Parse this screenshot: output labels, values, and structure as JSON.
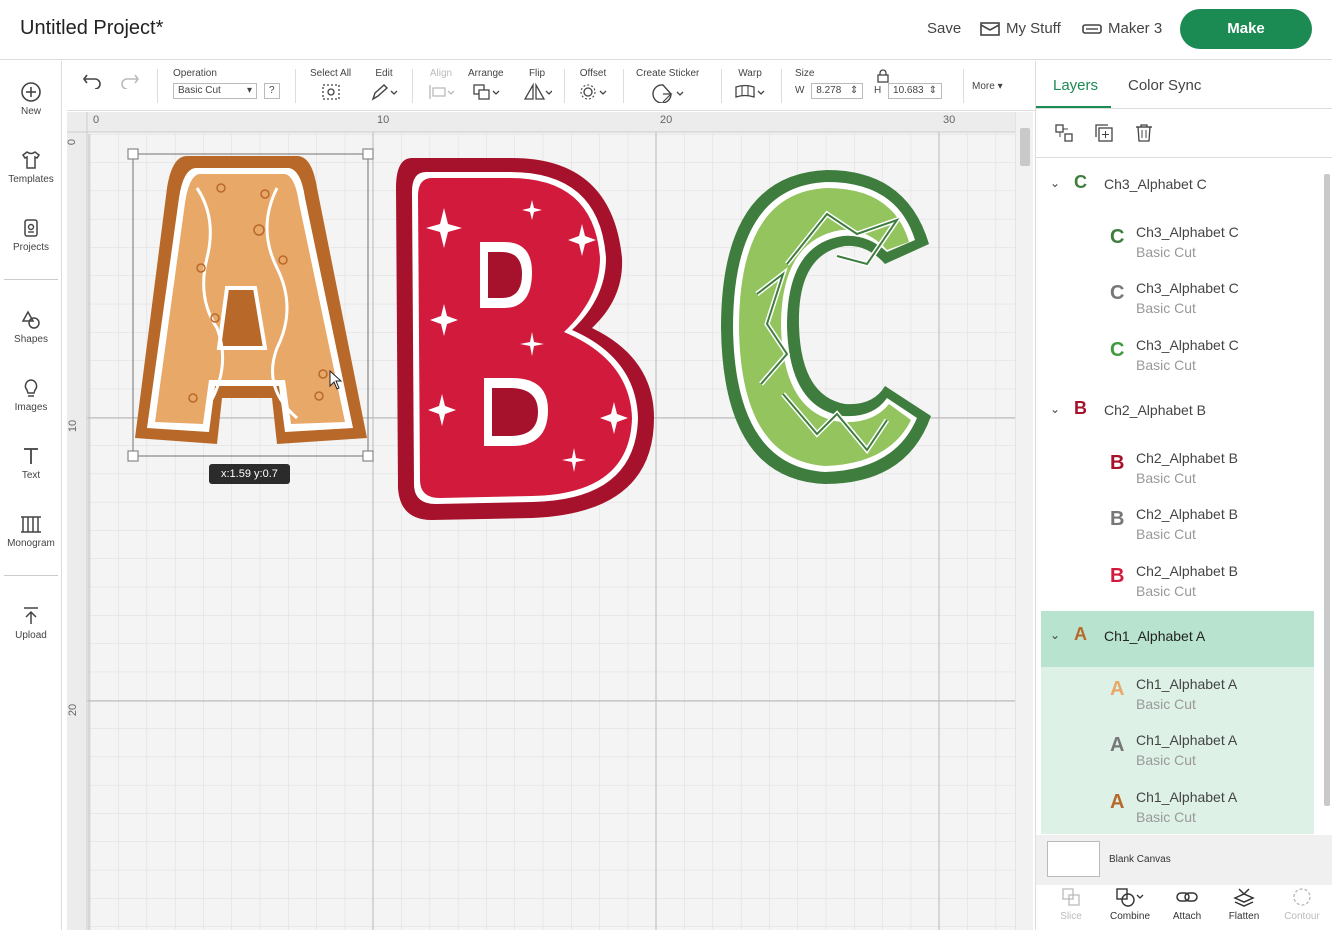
{
  "header": {
    "title": "Untitled Project*",
    "save": "Save",
    "my_stuff": "My Stuff",
    "machine": "Maker 3",
    "make": "Make"
  },
  "leftbar": {
    "items": [
      {
        "label": "New",
        "icon": "plus-circle-icon"
      },
      {
        "label": "Templates",
        "icon": "shirt-icon"
      },
      {
        "label": "Projects",
        "icon": "projects-icon"
      },
      {
        "label": "Shapes",
        "icon": "shapes-icon"
      },
      {
        "label": "Images",
        "icon": "lightbulb-icon"
      },
      {
        "label": "Text",
        "icon": "text-icon"
      },
      {
        "label": "Monogram",
        "icon": "monogram-icon"
      },
      {
        "label": "Upload",
        "icon": "upload-icon"
      }
    ]
  },
  "toolbar": {
    "operation_label": "Operation",
    "operation_value": "Basic Cut",
    "help": "?",
    "select_all": "Select All",
    "edit": "Edit",
    "align": "Align",
    "arrange": "Arrange",
    "flip": "Flip",
    "offset": "Offset",
    "create_sticker": "Create Sticker",
    "warp": "Warp",
    "size": "Size",
    "w_label": "W",
    "w_value": "8.278",
    "h_label": "H",
    "h_value": "10.683",
    "more": "More"
  },
  "ruler": {
    "top": [
      "0",
      "10",
      "20",
      "30"
    ],
    "left": [
      "0",
      "10",
      "20"
    ]
  },
  "canvas": {
    "tooltip": "x:1.59 y:0.7"
  },
  "panel": {
    "tabs": [
      "Layers",
      "Color Sync"
    ],
    "groups": [
      {
        "name": "Ch3_Alphabet C",
        "color": "#3f7d3f",
        "children": [
          {
            "name": "Ch3_Alphabet C",
            "op": "Basic Cut"
          },
          {
            "name": "Ch3_Alphabet C",
            "op": "Basic Cut"
          },
          {
            "name": "Ch3_Alphabet C",
            "op": "Basic Cut"
          }
        ]
      },
      {
        "name": "Ch2_Alphabet B",
        "color": "#a6122b",
        "children": [
          {
            "name": "Ch2_Alphabet B",
            "op": "Basic Cut"
          },
          {
            "name": "Ch2_Alphabet B",
            "op": "Basic Cut"
          },
          {
            "name": "Ch2_Alphabet B",
            "op": "Basic Cut"
          }
        ]
      },
      {
        "name": "Ch1_Alphabet A",
        "color": "#b8692a",
        "children": [
          {
            "name": "Ch1_Alphabet A",
            "op": "Basic Cut"
          },
          {
            "name": "Ch1_Alphabet A",
            "op": "Basic Cut"
          },
          {
            "name": "Ch1_Alphabet A",
            "op": "Basic Cut"
          }
        ]
      }
    ],
    "blank_canvas": "Blank Canvas",
    "bottom_tools": [
      "Slice",
      "Combine",
      "Attach",
      "Flatten",
      "Contour"
    ]
  },
  "colors": {
    "accent": "#1c8a53",
    "selected_bg": "#b7e3cf",
    "selected_light": "#ddf1e7"
  }
}
